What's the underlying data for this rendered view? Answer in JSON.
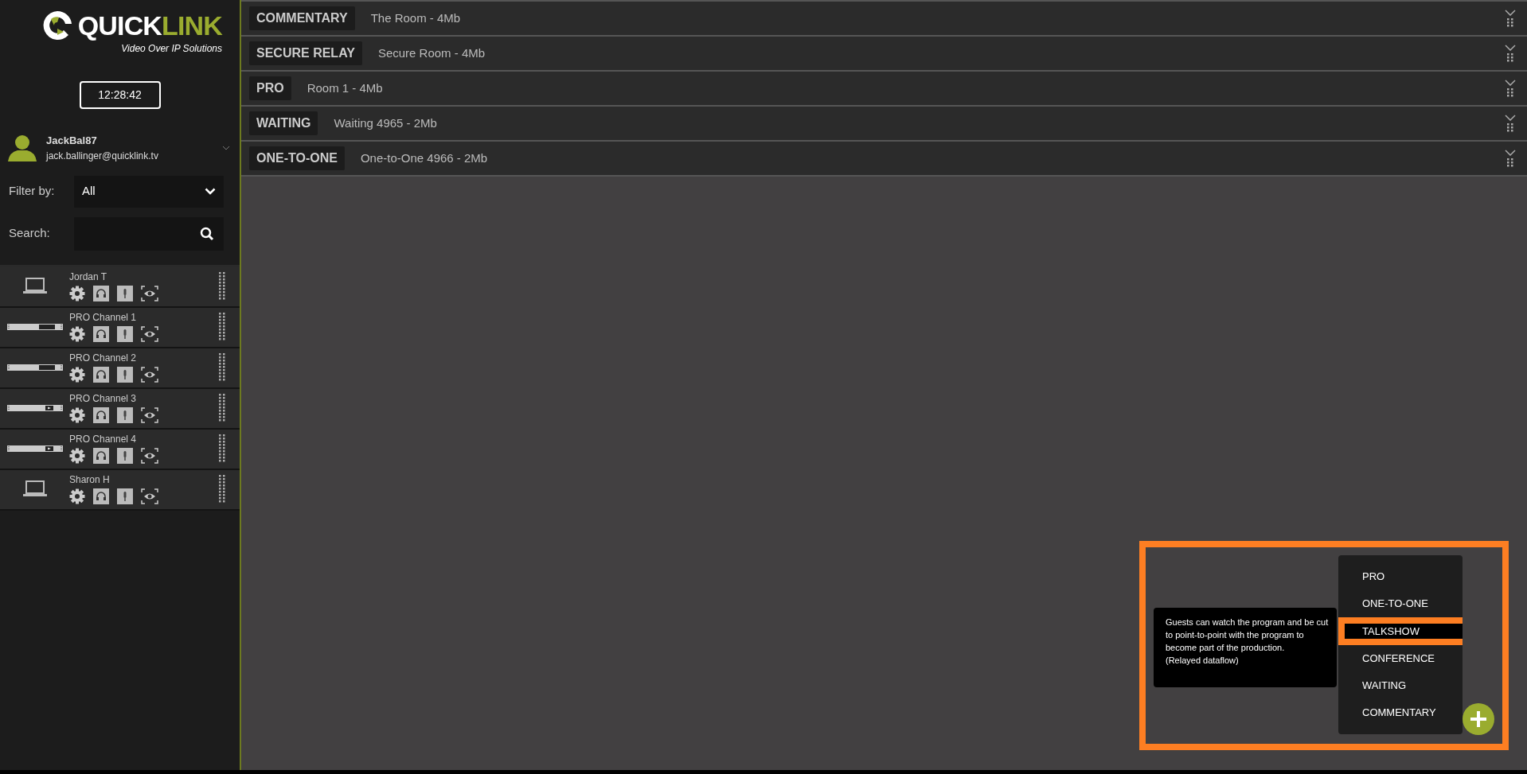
{
  "logo": {
    "brand_first": "QUICK",
    "brand_second": "LINK",
    "tagline": "Video Over IP Solutions"
  },
  "clock": "12:28:42",
  "user": {
    "name": "JackBal87",
    "email": "jack.ballinger@quicklink.tv"
  },
  "filter": {
    "label": "Filter by:",
    "value": "All"
  },
  "search": {
    "label": "Search:"
  },
  "devices": [
    {
      "name": "Jordan T",
      "kind": "laptop"
    },
    {
      "name": "PRO Channel 1",
      "kind": "pro"
    },
    {
      "name": "PRO Channel 2",
      "kind": "pro"
    },
    {
      "name": "PRO Channel 3",
      "kind": "play"
    },
    {
      "name": "PRO Channel 4",
      "kind": "play"
    },
    {
      "name": "Sharon H",
      "kind": "laptop"
    }
  ],
  "rooms": [
    {
      "type": "COMMENTARY",
      "name": "The Room - 4Mb"
    },
    {
      "type": "SECURE RELAY",
      "name": "Secure Room - 4Mb"
    },
    {
      "type": "PRO",
      "name": "Room 1 - 4Mb"
    },
    {
      "type": "WAITING",
      "name": "Waiting 4965 - 2Mb"
    },
    {
      "type": "ONE-TO-ONE",
      "name": "One-to-One 4966 - 2Mb"
    }
  ],
  "room_type_menu": {
    "items": [
      {
        "label": "PRO",
        "selected": false
      },
      {
        "label": "ONE-TO-ONE",
        "selected": false
      },
      {
        "label": "TALKSHOW",
        "selected": true
      },
      {
        "label": "CONFERENCE",
        "selected": false
      },
      {
        "label": "WAITING",
        "selected": false
      },
      {
        "label": "COMMENTARY",
        "selected": false
      }
    ],
    "tooltip": "Guests can watch the program and be cut to point-to-point with the program to become part of the production.\n(Relayed dataflow)"
  }
}
